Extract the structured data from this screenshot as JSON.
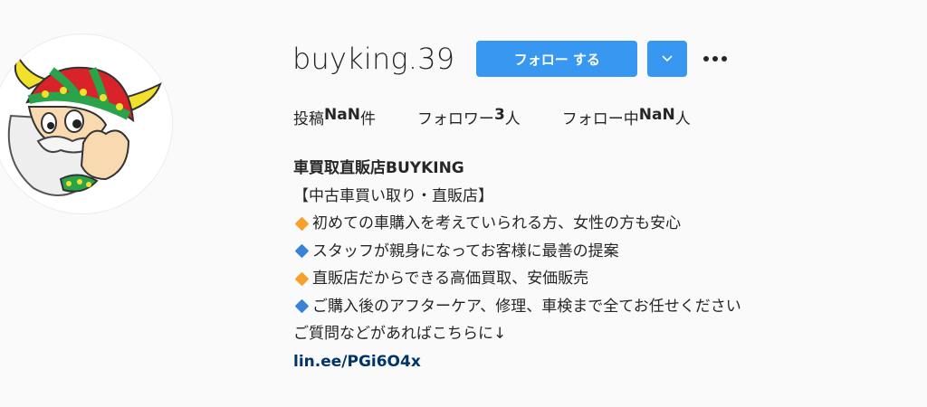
{
  "profile": {
    "username": "buyking.39",
    "follow_label": "フォロー する",
    "stats": {
      "posts_label": "投稿",
      "posts_value": "NaN",
      "posts_unit": "件",
      "followers_label": "フォロワー",
      "followers_value": "3",
      "followers_unit": "人",
      "following_label": "フォロー中",
      "following_value": "NaN",
      "following_unit": "人"
    }
  },
  "bio": {
    "name": "車買取直販店BUYKING",
    "lines": [
      {
        "text": "【中古車買い取り・直販店】",
        "bullet": ""
      },
      {
        "text": "初めての車購入を考えていられる方、女性の方も安心",
        "bullet": "orange-diamond"
      },
      {
        "text": "スタッフが親身になってお客様に最善の提案",
        "bullet": "blue-diamond"
      },
      {
        "text": "直販店だからできる高価買取、安価販売",
        "bullet": "orange-diamond"
      },
      {
        "text": "ご購入後のアフターケア、修理、車検まで全てお任せください",
        "bullet": "blue-diamond"
      },
      {
        "text": "ご質問などがあればこちらに↓",
        "bullet": ""
      }
    ],
    "link": "lin.ee/PGi6O4x"
  },
  "colors": {
    "follow_button": "#3897f0",
    "link": "#003569",
    "orange_diamond": "#f7a02a",
    "blue_diamond": "#3b82d6"
  },
  "icons": {
    "dropdown": "chevron-down-icon",
    "options": "more-options-icon"
  }
}
